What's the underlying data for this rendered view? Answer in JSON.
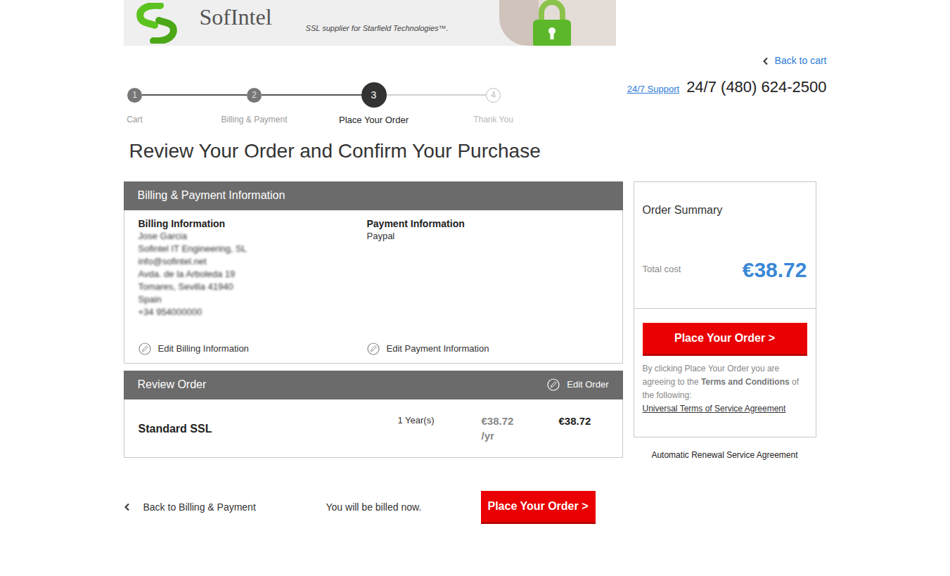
{
  "banner": {
    "brand": "SofIntel",
    "tagline": "SSL supplier for Starfield Technologies™."
  },
  "back_to_cart": "Back to cart",
  "support": {
    "link": "24/7 Support",
    "phone": "24/7 (480) 624-2500"
  },
  "steps": [
    {
      "number": "1",
      "label": "Cart",
      "completed": true,
      "selected": false
    },
    {
      "number": "2",
      "label": "Billing & Payment",
      "completed": true,
      "selected": false
    },
    {
      "number": "3",
      "label": "Place Your Order",
      "completed": false,
      "selected": true
    },
    {
      "number": "4",
      "label": "Thank You",
      "completed": false,
      "selected": false
    }
  ],
  "heading": "Review Your Order and Confirm Your Purchase",
  "billing_panel": {
    "title": "Billing & Payment Information",
    "billing": {
      "title": "Billing Information",
      "blurred": true,
      "lines": [
        "Jose Garcia",
        "Sofintel IT Engineering, SL",
        "info@sofintel.net",
        "Avda. de la Arboleda 19",
        "Tomares, Sevilla 41940",
        "Spain",
        "+34 954000000"
      ],
      "edit": "Edit Billing Information"
    },
    "payment": {
      "title": "Payment Information",
      "blurred": false,
      "lines": [
        "Paypal"
      ],
      "edit": "Edit Payment Information"
    }
  },
  "review_panel": {
    "title": "Review Order",
    "edit": "Edit Order",
    "items": [
      {
        "name": "Standard SSL",
        "term": "1 Year(s)",
        "price": "€38.72",
        "per": "/yr",
        "total": "€38.72"
      }
    ]
  },
  "summary": {
    "title": "Order Summary",
    "total_label": "Total cost",
    "total": "€38.72",
    "button": "Place Your Order >",
    "terms_text": "By clicking Place Your Order you are agreeing to the ",
    "terms_bold": "Terms and Conditions",
    "terms_after": " of the following:",
    "terms_link": "Universal Terms of Service Agreement"
  },
  "renewal_link": "Automatic Renewal Service Agreement",
  "footer": {
    "back": "Back to Billing & Payment",
    "billed_note": "You will be billed now.",
    "button": "Place Your Order >"
  }
}
